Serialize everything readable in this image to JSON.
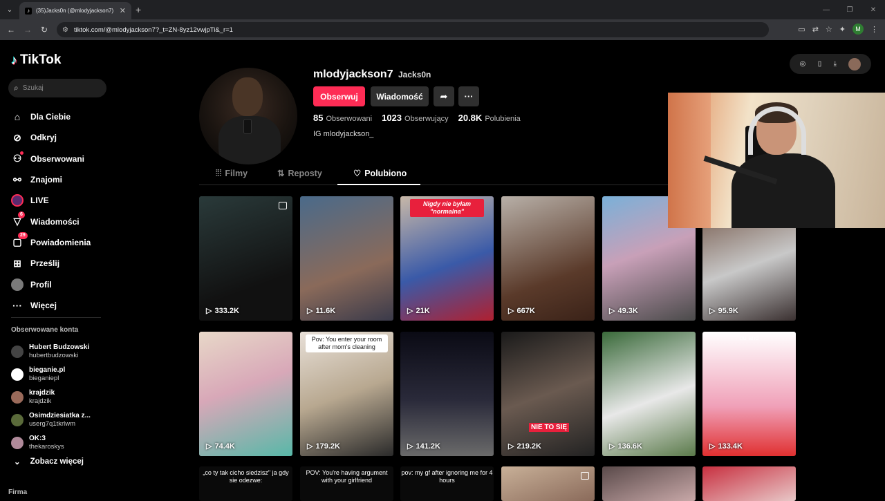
{
  "browser": {
    "tab_title": "(35)Jacks0n (@mlodyjackson7) |",
    "url": "tiktok.com/@mlodyjackson7?_t=ZN-8yz12vwjpTi&_r=1",
    "profile_initial": "M"
  },
  "app": {
    "logo": "TikTok",
    "search_placeholder": "Szukaj",
    "menu": [
      {
        "label": "Dla Ciebie",
        "icon": "home-icon"
      },
      {
        "label": "Odkryj",
        "icon": "compass-icon"
      },
      {
        "label": "Obserwowani",
        "icon": "following-icon"
      },
      {
        "label": "Znajomi",
        "icon": "friends-icon"
      },
      {
        "label": "LIVE",
        "icon": "live-icon"
      },
      {
        "label": "Wiadomości",
        "icon": "messages-icon",
        "badge": "6"
      },
      {
        "label": "Powiadomienia",
        "icon": "notifications-icon",
        "badge": "29"
      },
      {
        "label": "Prześlij",
        "icon": "upload-icon"
      },
      {
        "label": "Profil",
        "icon": "profile-icon"
      },
      {
        "label": "Więcej",
        "icon": "more-icon"
      }
    ],
    "followed_title": "Obserwowane konta",
    "followed": [
      {
        "name": "Hubert Budzowski",
        "user": "hubertbudzowski",
        "color": "#444"
      },
      {
        "name": "bieganie.pl",
        "user": "bieganiepl",
        "color": "#fff"
      },
      {
        "name": "krajdzik",
        "user": "krajdzik",
        "color": "#9a6a5a"
      },
      {
        "name": "Osimdziesiatka z...",
        "user": "userg7q1tkrlwm",
        "color": "#5a6a3a"
      },
      {
        "name": "OK:3",
        "user": "thekaroskys",
        "color": "#b08a9a"
      }
    ],
    "see_more": "Zobacz więcej",
    "firma": "Firma"
  },
  "profile": {
    "username": "mlodyjackson7",
    "nickname": "Jacks0n",
    "follow_btn": "Obserwuj",
    "message_btn": "Wiadomość",
    "stats": {
      "following_num": "85",
      "following_label": "Obserwowani",
      "followers_num": "1023",
      "followers_label": "Obserwujący",
      "likes_num": "20.8K",
      "likes_label": "Polubienia"
    },
    "bio": "IG mlodyjackson_"
  },
  "tabs": [
    {
      "label": "Filmy",
      "icon": "grid-icon"
    },
    {
      "label": "Reposty",
      "icon": "repost-icon"
    },
    {
      "label": "Polubiono",
      "icon": "heart-icon"
    }
  ],
  "videos": [
    {
      "views": "333.2K",
      "bg": "linear-gradient(160deg,#2a3a3a,#111 70%)"
    },
    {
      "views": "11.6K",
      "bg": "linear-gradient(160deg,#4a6a8a,#8a6a5a 60%,#3a3a4a)"
    },
    {
      "views": "21K",
      "bg": "linear-gradient(160deg,#c8b8a8,#3a5aa8 55%,#b02030)",
      "caption": "Nigdy nie byłam \"normalna\"",
      "cap_style": "red"
    },
    {
      "views": "667K",
      "bg": "linear-gradient(160deg,#b8b0a8,#5a3a2a 65%,#3a2218)"
    },
    {
      "views": "49.3K",
      "bg": "linear-gradient(160deg,#7ab0d8,#c8a0b8 45%,#4a4a4a)"
    },
    {
      "views": "95.9K",
      "bg": "linear-gradient(160deg,#6a4a3a,#c8c8c8 55%,#3a3030)"
    },
    {
      "views": "74.4K",
      "bg": "linear-gradient(160deg,#e8d8c8,#d8a8b8 45%,#58b8a8)"
    },
    {
      "views": "179.2K",
      "bg": "linear-gradient(160deg,#e8e0d8,#b8a890 50%,#2a2a2a)",
      "caption": "Pov: You enter your room after mom's cleaning",
      "cap_style": "white"
    },
    {
      "views": "141.2K",
      "bg": "linear-gradient(180deg,#0a0a14,#2a2a3a 55%,#6a6a6a)"
    },
    {
      "views": "219.2K",
      "bg": "linear-gradient(160deg,#1a1a1a,#6a5a50 50%,#222)",
      "mid": "NIE TO SIĘ"
    },
    {
      "views": "136.6K",
      "bg": "linear-gradient(160deg,#3a6a3a,#e8e8e8 55%,#5a7a4a)"
    },
    {
      "views": "133.4K",
      "bg": "linear-gradient(180deg,#fff,#f0a0b8 60%,#e03030)",
      "caption": "ou and",
      "cap_style": "black"
    },
    {
      "views": "",
      "bg": "#0a0a0a",
      "caption": "„co ty tak cicho siedzisz\" ja gdy sie odezwe:",
      "cap_style": "black"
    },
    {
      "views": "",
      "bg": "#0a0a0a",
      "caption": "POV: You're having argument with your girlfriend",
      "cap_style": "black"
    },
    {
      "views": "",
      "bg": "#0a0a0a",
      "caption": "pov: my gf after ignoring me for 4 hours",
      "cap_style": "black"
    },
    {
      "views": "",
      "bg": "linear-gradient(160deg,#c8b098,#8a6a5a)"
    },
    {
      "views": "",
      "bg": "linear-gradient(160deg,#5a4a4a,#c8a8a8)"
    },
    {
      "views": "",
      "bg": "linear-gradient(160deg,#c83040,#e8c8c8)"
    }
  ]
}
